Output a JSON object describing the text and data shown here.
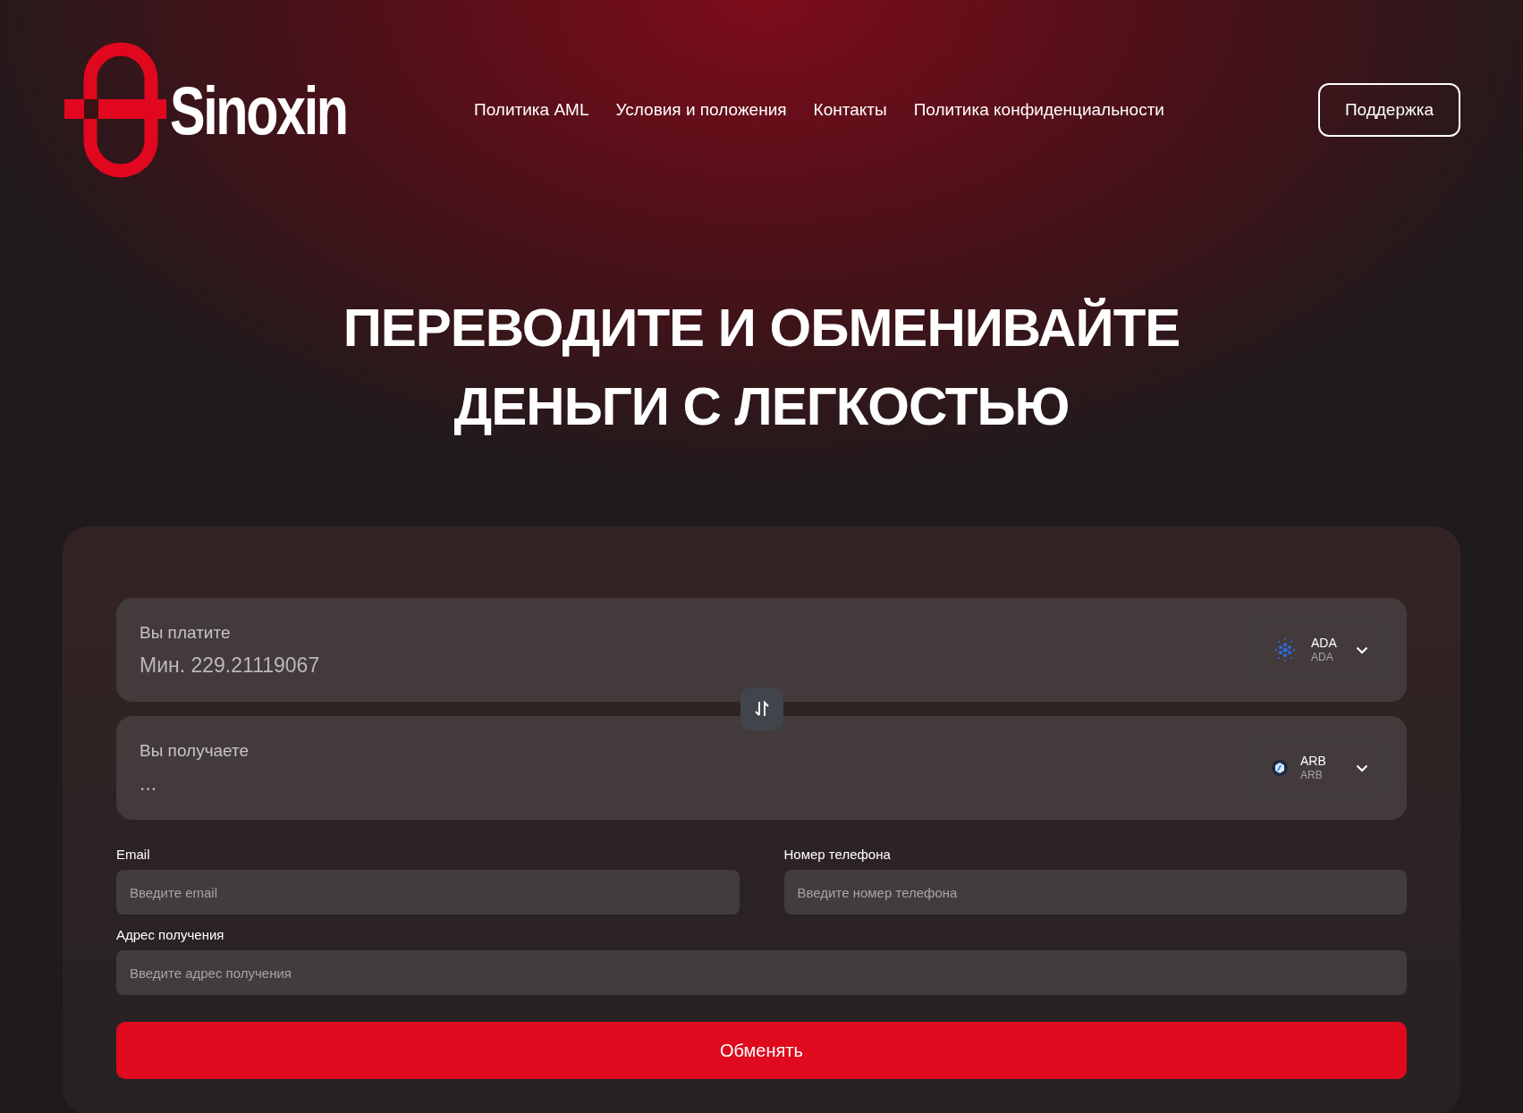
{
  "header": {
    "logo": "Sinoxin",
    "nav": [
      "Политика AML",
      "Условия и положения",
      "Контакты",
      "Политика конфиденциальности"
    ],
    "support_button": "Поддержка"
  },
  "hero": {
    "title_lines": [
      "ПЕРЕВОДИТЕ И ОБМЕНИВАЙТЕ",
      "ДЕНЬГИ С ЛЕГКОСТЬЮ"
    ]
  },
  "exchange": {
    "amounts": [
      {
        "label": "Вы платите",
        "placeholder": "Мин. 229.21119067",
        "currency": {
          "code": "ADA",
          "name": "ADA"
        }
      },
      {
        "label": "Вы получаете",
        "placeholder": "...",
        "currency": {
          "code": "ARB",
          "name": "ARB"
        }
      }
    ],
    "fields": [
      {
        "label": "Email",
        "placeholder": "Введите email"
      },
      {
        "label": "Номер телефона",
        "placeholder": "Введите номер телефона"
      },
      {
        "label": "Адрес получения",
        "placeholder": "Введите адрес получения"
      }
    ],
    "submit": "Обменять"
  }
}
